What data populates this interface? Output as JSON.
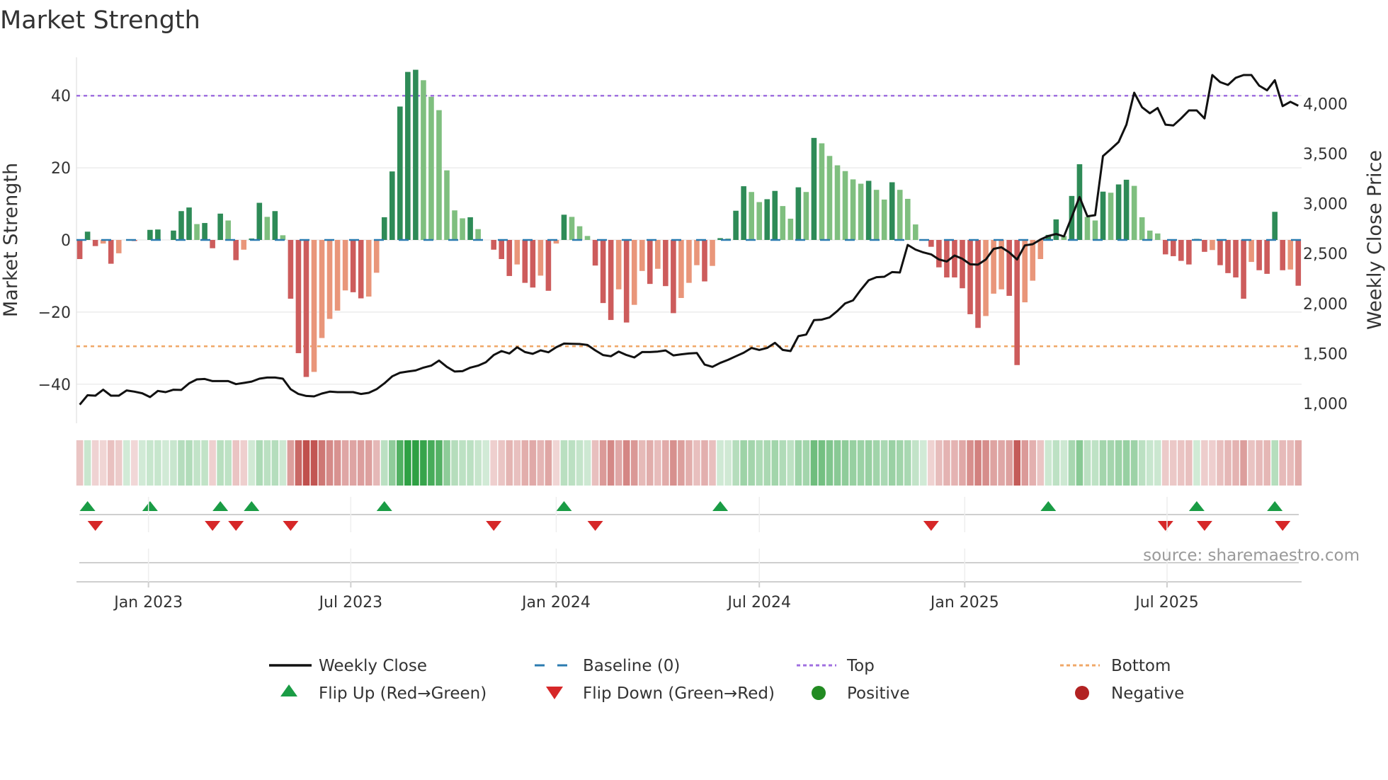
{
  "title": "Market Strength",
  "source": "source: sharemaestro.com",
  "colors": {
    "pos_strong": "#2e8b57",
    "pos_weak": "#7fbf7f",
    "neg_strong": "#cd5c5c",
    "neg_weak": "#e9967a",
    "heat_pos": "#2ea043",
    "heat_neg": "#c0504d",
    "top": "#a070e0",
    "bottom": "#f0a868",
    "baseline": "#2b7bb0",
    "price": "#111111",
    "flip_up": "#1a9c45",
    "flip_down": "#d62728",
    "positive": "#228b22",
    "negative": "#b22222"
  },
  "chart_data": {
    "type": "bar",
    "title": "Market Strength",
    "ylabel": "Market Strength",
    "ylabel_right": "Weekly Close Price",
    "ylim": [
      -51,
      51
    ],
    "ylim_right": [
      805,
      4460
    ],
    "yticks": [
      {
        "v": 40,
        "label": "40"
      },
      {
        "v": 20,
        "label": "20"
      },
      {
        "v": 0,
        "label": "0"
      },
      {
        "v": -20,
        "label": "−20"
      },
      {
        "v": -40,
        "label": "−40"
      }
    ],
    "yticks_right": [
      {
        "v": 1000,
        "label": "1,000"
      },
      {
        "v": 1500,
        "label": "1,500"
      },
      {
        "v": 2000,
        "label": "2,000"
      },
      {
        "v": 2500,
        "label": "2,500"
      },
      {
        "v": 3000,
        "label": "3,000"
      },
      {
        "v": 3500,
        "label": "3,500"
      },
      {
        "v": 4000,
        "label": "4,000"
      }
    ],
    "xticks": [
      {
        "week": 8.8,
        "label": "Jan 2023"
      },
      {
        "week": 34.7,
        "label": "Jul 2023"
      },
      {
        "week": 61,
        "label": "Jan 2024"
      },
      {
        "week": 87,
        "label": "Jul 2024"
      },
      {
        "week": 113.3,
        "label": "Jan 2025"
      },
      {
        "week": 139.2,
        "label": "Jul 2025"
      }
    ],
    "top_level": 40,
    "bottom_level": -29.5,
    "baseline": 0,
    "strength": [
      -5.3,
      2.3,
      -1.7,
      -1,
      -6.6,
      -3.7,
      0,
      -0.3,
      0,
      2.8,
      2.9,
      0,
      2.6,
      8,
      9,
      4.4,
      4.7,
      -2.3,
      7.3,
      5.4,
      -5.6,
      -2.7,
      0.4,
      10.3,
      6.4,
      8,
      1.3,
      -16.3,
      -31.4,
      -38,
      -36.6,
      -27.2,
      -21.9,
      -19.6,
      -14,
      -14.5,
      -16.2,
      -15.7,
      -9.1,
      6.3,
      19,
      37,
      46.6,
      47.2,
      44.3,
      39.7,
      36,
      19.3,
      8.2,
      6,
      6.3,
      3,
      0,
      -2.7,
      -5.3,
      -10,
      -6.8,
      -11.9,
      -13.2,
      -9.9,
      -14.1,
      -1,
      7,
      6.4,
      3.8,
      1.1,
      -7.1,
      -17.5,
      -22.2,
      -13.7,
      -22.9,
      -18,
      -8.6,
      -12.2,
      -8,
      -12.8,
      -20.3,
      -16.1,
      -11.9,
      -7,
      -11.5,
      -7.2,
      0.5,
      0.4,
      8.1,
      14.9,
      13.3,
      10.5,
      11.3,
      13.6,
      9.4,
      5.9,
      14.6,
      13.3,
      28.3,
      26.8,
      23.3,
      20.7,
      19.1,
      16.8,
      15.6,
      16.4,
      13.9,
      11.2,
      16,
      13.9,
      11.4,
      4.3,
      0,
      -1.9,
      -7.6,
      -10.4,
      -10.4,
      -13.4,
      -20.6,
      -24.4,
      -21.1,
      -14.9,
      -13.7,
      -15.5,
      -34.7,
      -17.3,
      -11.3,
      -5.3,
      1.4,
      5.7,
      1.1,
      12.2,
      21,
      6.4,
      5.4,
      13.4,
      13.1,
      15.4,
      16.7,
      15,
      6.3,
      2.6,
      1.8,
      -4,
      -4.5,
      -5.8,
      -6.8,
      0.3,
      -3.3,
      -2.8,
      -7,
      -9.2,
      -10.4,
      -16.3,
      -6.1,
      -8.4,
      -9.4,
      7.8,
      -8.4,
      -8.2,
      -12.7
    ],
    "weekly_close": [
      988,
      1082,
      1078,
      1137,
      1078,
      1078,
      1130,
      1118,
      1102,
      1064,
      1125,
      1113,
      1137,
      1135,
      1201,
      1241,
      1245,
      1224,
      1224,
      1224,
      1193,
      1205,
      1219,
      1248,
      1259,
      1259,
      1248,
      1142,
      1095,
      1075,
      1071,
      1099,
      1118,
      1113,
      1113,
      1113,
      1095,
      1106,
      1142,
      1201,
      1271,
      1307,
      1319,
      1330,
      1358,
      1378,
      1429,
      1366,
      1319,
      1323,
      1358,
      1378,
      1413,
      1484,
      1524,
      1500,
      1562,
      1514,
      1496,
      1531,
      1512,
      1562,
      1599,
      1597,
      1595,
      1585,
      1531,
      1484,
      1472,
      1519,
      1484,
      1460,
      1514,
      1514,
      1519,
      1530,
      1481,
      1491,
      1500,
      1505,
      1389,
      1366,
      1406,
      1436,
      1472,
      1507,
      1555,
      1535,
      1555,
      1606,
      1535,
      1524,
      1673,
      1689,
      1833,
      1838,
      1861,
      1925,
      2001,
      2031,
      2137,
      2232,
      2263,
      2267,
      2314,
      2310,
      2586,
      2539,
      2511,
      2491,
      2440,
      2420,
      2480,
      2447,
      2392,
      2388,
      2440,
      2546,
      2562,
      2511,
      2440,
      2581,
      2593,
      2640,
      2675,
      2695,
      2671,
      2865,
      3065,
      2872,
      2883,
      3474,
      3544,
      3615,
      3789,
      4108,
      3962,
      3903,
      3955,
      3789,
      3780,
      3851,
      3931,
      3931,
      3851,
      4285,
      4214,
      4186,
      4257,
      4285,
      4285,
      4179,
      4132,
      4233,
      3974,
      4017,
      3978
    ],
    "flip_up_weeks": [
      1,
      9,
      18,
      22,
      39,
      62,
      82,
      124,
      143,
      153
    ],
    "flip_down_weeks": [
      2,
      17,
      20,
      27,
      53,
      66,
      109,
      139,
      144,
      154
    ],
    "legend": {
      "placement": "bottom",
      "items": [
        {
          "key": "weekly_close",
          "label": "Weekly Close"
        },
        {
          "key": "baseline",
          "label": "Baseline (0)"
        },
        {
          "key": "top",
          "label": "Top"
        },
        {
          "key": "bottom",
          "label": "Bottom"
        },
        {
          "key": "flip_up",
          "label": "Flip Up (Red→Green)"
        },
        {
          "key": "flip_down",
          "label": "Flip Down (Green→Red)"
        },
        {
          "key": "positive",
          "label": "Positive"
        },
        {
          "key": "negative",
          "label": "Negative"
        }
      ]
    }
  }
}
